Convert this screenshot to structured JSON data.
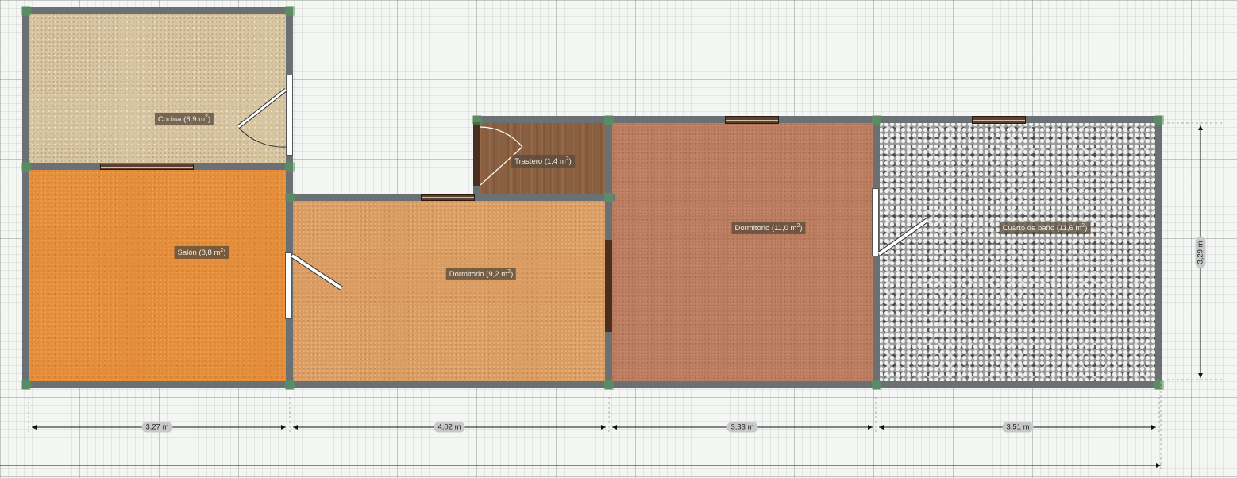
{
  "rooms": {
    "cocina": {
      "name": "Cocina",
      "area": "(6,9 m",
      "exp": "2",
      "close": ")"
    },
    "salon": {
      "name": "Salón",
      "area": "(8,8 m",
      "exp": "2",
      "close": ")"
    },
    "dormitorio1": {
      "name": "Dormitorio",
      "area": "(9,2 m",
      "exp": "2",
      "close": ")"
    },
    "trastero": {
      "name": "Trastero",
      "area": "(1,4 m",
      "exp": "2",
      "close": ")"
    },
    "dormitorio2": {
      "name": "Dormitorio",
      "area": "(11,0 m",
      "exp": "2",
      "close": ")"
    },
    "bano": {
      "name": "Cuarto de baño",
      "area": "(11,6 m",
      "exp": "2",
      "close": ")"
    }
  },
  "dimensions": {
    "d1": "3,27 m",
    "d2": "4,02 m",
    "d3": "3,33 m",
    "d4": "3,51 m",
    "height": "3,29 m"
  },
  "colors": {
    "wall": "#6b7074",
    "cocina_floor": "#d8c5a2",
    "salon_floor": "#e38d3a",
    "dormitorio1_floor": "#d99c62",
    "trastero_floor": "#8a6040",
    "dormitorio2_floor": "#b87b5e",
    "bano_floor": "#9a9a9a"
  }
}
